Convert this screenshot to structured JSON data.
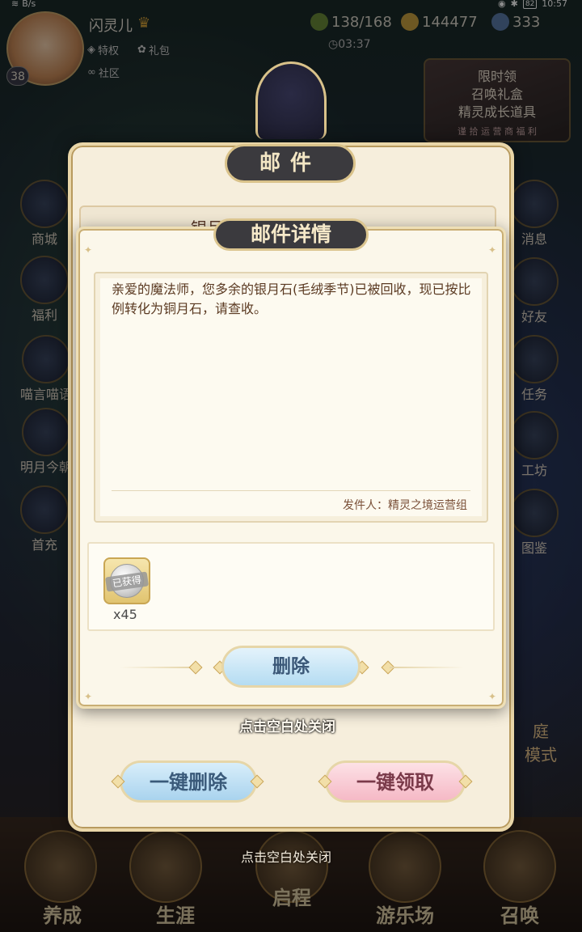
{
  "status_bar": {
    "net_speed_unit": "B/s",
    "battery": "82",
    "time": "10:57"
  },
  "player": {
    "name": "闪灵儿",
    "level": "38",
    "links": [
      "特权",
      "礼包",
      "社区"
    ]
  },
  "resources": {
    "stamina": "138/168",
    "gold": "144477",
    "gems": "333",
    "timer": "03:37"
  },
  "promo": {
    "line1": "限时领",
    "line2": "召唤礼盒",
    "line3": "精灵成长道具",
    "sub": "谨 拾 运 营 商 福 利"
  },
  "left_menu": [
    "商城",
    "福利",
    "喵言喵语",
    "明月今朝",
    "首充"
  ],
  "right_menu": [
    "消息",
    "好友",
    "任务",
    "工坊",
    "图鉴"
  ],
  "right_extra": "庭\n模式",
  "bottom_tabs": [
    "养成",
    "生涯",
    "启程",
    "游乐场",
    "召唤"
  ],
  "mail_panel": {
    "title": "邮件",
    "first_mail_subject": "银月石回收说明",
    "delete_all": "一键删除",
    "claim_all": "一键领取",
    "close_hint_lower": "点击空白处关闭"
  },
  "detail": {
    "title": "邮件详情",
    "body": "亲爱的魔法师，您多余的银月石(毛绒季节)已被回收，现已按比例转化为铜月石，请查收。",
    "sender": "发件人：精灵之境运营组",
    "attachment": {
      "tag": "已获得",
      "quantity": "x45"
    },
    "delete_button": "删除",
    "close_hint": "点击空白处关闭"
  }
}
